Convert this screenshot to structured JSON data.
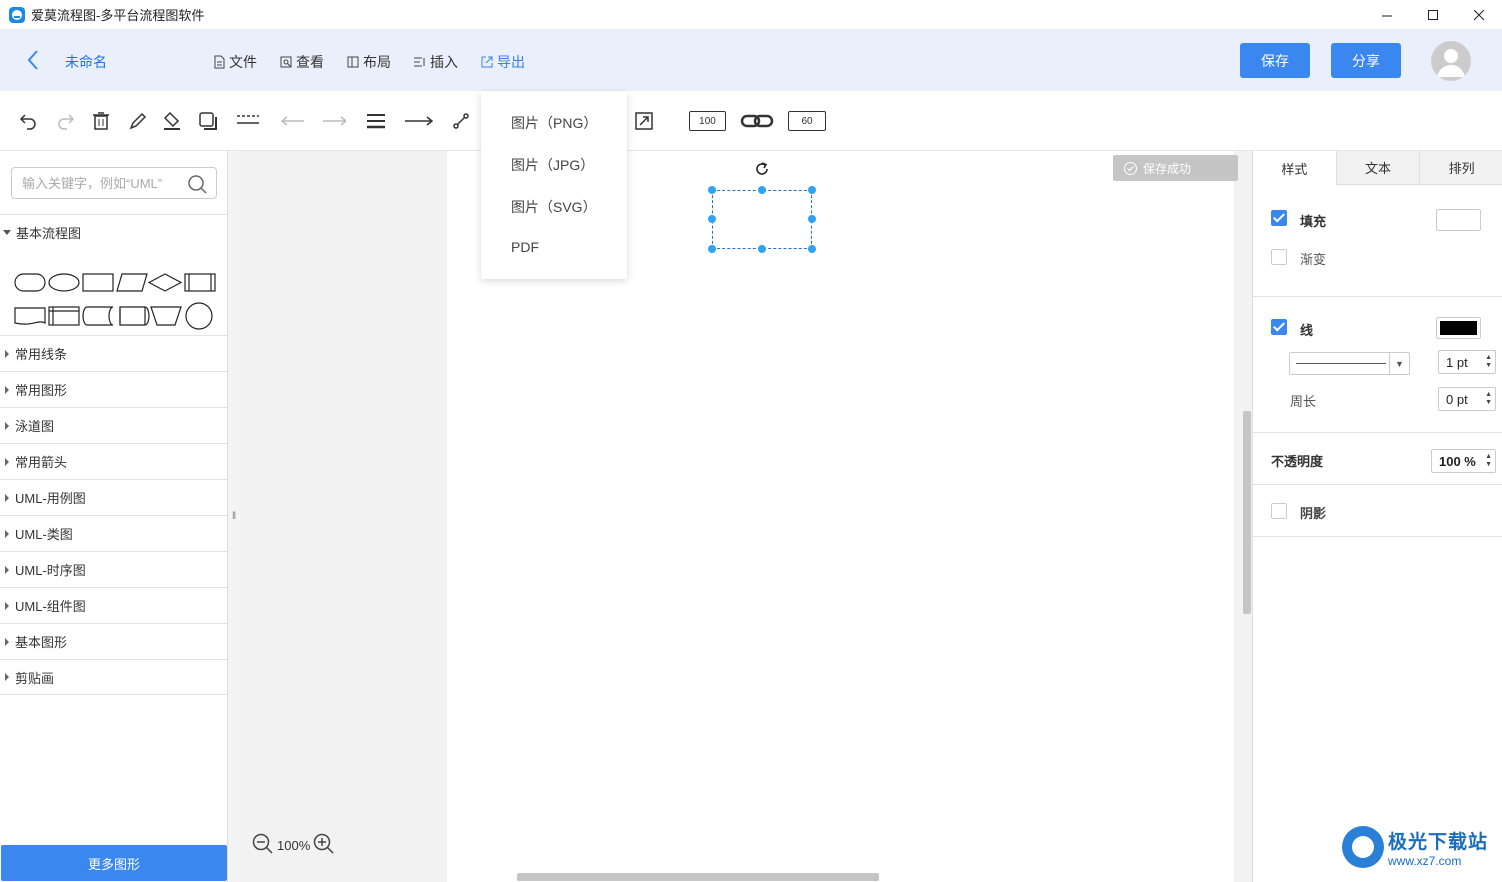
{
  "window": {
    "title": "爱莫流程图-多平台流程图软件",
    "controls": [
      "minimize",
      "maximize",
      "close"
    ]
  },
  "header": {
    "doc_name": "未命名",
    "menu": [
      {
        "label": "文件",
        "icon": "file-icon"
      },
      {
        "label": "查看",
        "icon": "view-icon"
      },
      {
        "label": "布局",
        "icon": "layout-icon"
      },
      {
        "label": "插入",
        "icon": "insert-icon"
      },
      {
        "label": "导出",
        "icon": "export-icon",
        "active": true
      }
    ],
    "save_label": "保存",
    "share_label": "分享"
  },
  "toolbar": {
    "tools": [
      "undo-icon",
      "redo-icon",
      "delete-icon",
      "pen-icon",
      "fill-icon",
      "shadow-icon",
      "dash-style-icon",
      "arrow-left-icon",
      "arrow-right-icon",
      "line-weight-icon",
      "line-arrow-icon",
      "connector-icon",
      "fit-icon",
      "link-icon"
    ],
    "width_value": "100",
    "height_value": "60"
  },
  "export_menu": {
    "items": [
      "图片（PNG）",
      "图片（JPG）",
      "图片（SVG）",
      "PDF"
    ]
  },
  "sidebar": {
    "search_placeholder": "输入关键字，例如“UML”",
    "expanded_category": "基本流程图",
    "categories": [
      "常用线条",
      "常用图形",
      "泳道图",
      "常用箭头",
      "UML-用例图",
      "UML-类图",
      "UML-时序图",
      "UML-组件图",
      "基本图形",
      "剪贴画"
    ],
    "more_button": "更多图形"
  },
  "canvas": {
    "toast": "保存成功",
    "zoom": "100%"
  },
  "right_panel": {
    "tabs": [
      "样式",
      "文本",
      "排列"
    ],
    "fill_label": "填充",
    "fill_checked": true,
    "fill_color": "#ffffff",
    "gradient_label": "渐变",
    "gradient_checked": false,
    "line_label": "线",
    "line_checked": true,
    "line_color": "#000000",
    "line_width": "1 pt",
    "perimeter_label": "周长",
    "perimeter_value": "0 pt",
    "opacity_label": "不透明度",
    "opacity_value": "100 %",
    "shadow_label": "阴影",
    "shadow_checked": false
  },
  "watermark": {
    "title": "极光下载站",
    "url": "www.xz7.com"
  },
  "colors": {
    "accent": "#3a87f0",
    "header_bg": "#eaf0fb",
    "selection": "#2ea3f2"
  }
}
